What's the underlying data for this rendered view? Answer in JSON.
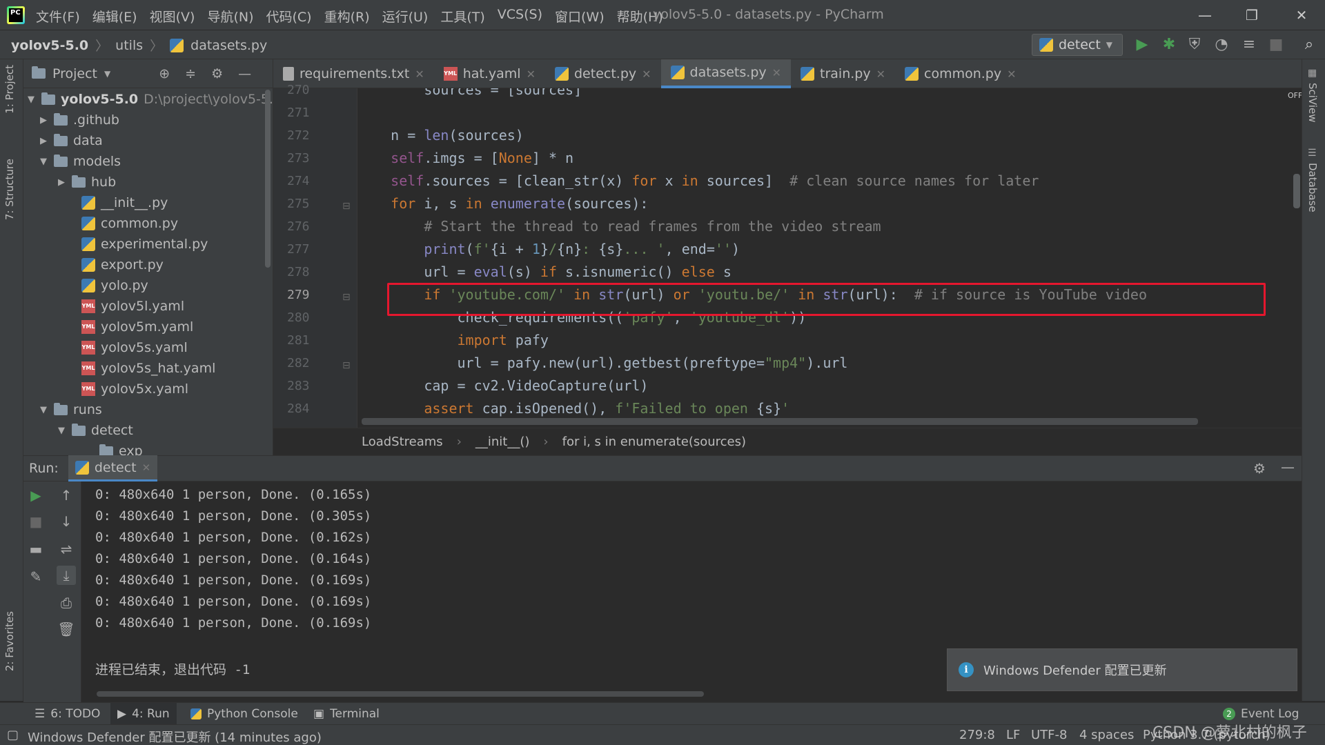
{
  "titlebar": {
    "menu": [
      "文件(F)",
      "编辑(E)",
      "视图(V)",
      "导航(N)",
      "代码(C)",
      "重构(R)",
      "运行(U)",
      "工具(T)",
      "VCS(S)",
      "窗口(W)",
      "帮助(H)"
    ],
    "window_title": "yolov5-5.0 - datasets.py - PyCharm",
    "logo_text": "PC"
  },
  "navbar": {
    "crumbs": [
      "yolov5-5.0",
      "utils",
      "datasets.py"
    ],
    "run_config": "detect"
  },
  "left_strip": {
    "project": "1: Project",
    "structure": "7: Structure",
    "favorites": "2: Favorites"
  },
  "right_strip": {
    "sciview": "SciView",
    "database": "Database"
  },
  "project": {
    "header": "Project",
    "root_name": "yolov5-5.0",
    "root_path": "D:\\project\\yolov5-5.0",
    "items": [
      {
        "label": ".github",
        "type": "folder"
      },
      {
        "label": "data",
        "type": "folder"
      },
      {
        "label": "models",
        "type": "folder"
      },
      {
        "label": "hub",
        "type": "folder"
      },
      {
        "label": "__init__.py",
        "type": "py"
      },
      {
        "label": "common.py",
        "type": "py"
      },
      {
        "label": "experimental.py",
        "type": "py"
      },
      {
        "label": "export.py",
        "type": "py"
      },
      {
        "label": "yolo.py",
        "type": "py"
      },
      {
        "label": "yolov5l.yaml",
        "type": "yml"
      },
      {
        "label": "yolov5m.yaml",
        "type": "yml"
      },
      {
        "label": "yolov5s.yaml",
        "type": "yml"
      },
      {
        "label": "yolov5s_hat.yaml",
        "type": "yml"
      },
      {
        "label": "yolov5x.yaml",
        "type": "yml"
      },
      {
        "label": "runs",
        "type": "folder"
      },
      {
        "label": "detect",
        "type": "folder"
      },
      {
        "label": "exp",
        "type": "folder"
      }
    ]
  },
  "tabs": [
    "requirements.txt",
    "hat.yaml",
    "detect.py",
    "datasets.py",
    "train.py",
    "common.py"
  ],
  "editor": {
    "line_numbers": [
      "270",
      "271",
      "272",
      "273",
      "274",
      "275",
      "276",
      "277",
      "278",
      "279",
      "280",
      "281",
      "282",
      "283",
      "284"
    ],
    "current_line": "279",
    "off_label": "OFF"
  },
  "editor_breadcrumb": [
    "LoadStreams",
    "__init__()",
    "for i, s in enumerate(sources)"
  ],
  "run": {
    "label": "Run:",
    "tab": "detect",
    "output": [
      "0: 480x640 1 person, Done. (0.165s)",
      "0: 480x640 1 person, Done. (0.305s)",
      "0: 480x640 1 person, Done. (0.162s)",
      "0: 480x640 1 person, Done. (0.164s)",
      "0: 480x640 1 person, Done. (0.169s)",
      "0: 480x640 1 person, Done. (0.169s)",
      "0: 480x640 1 person, Done. (0.169s)"
    ],
    "exit_message": "进程已结束，退出代码 -1"
  },
  "notification": {
    "text": "Windows Defender 配置已更新"
  },
  "tool_tabs": {
    "todo": "6: TODO",
    "run": "4: Run",
    "python_console": "Python Console",
    "terminal": "Terminal",
    "event_log": "Event Log",
    "event_count": "2"
  },
  "status": {
    "message": "Windows Defender 配置已更新 (14 minutes ago)",
    "position": "279:8",
    "line_sep": "LF",
    "encoding": "UTF-8",
    "indent": "4 spaces",
    "interpreter": "Python 3.7 (pytorch)"
  },
  "watermark": "CSDN @萝北村的枫子",
  "colors": {
    "highlight_box": "#e5172e",
    "keyword": "#cc7832",
    "string": "#6a8759",
    "comment": "#808080",
    "run_green": "#499c54"
  }
}
